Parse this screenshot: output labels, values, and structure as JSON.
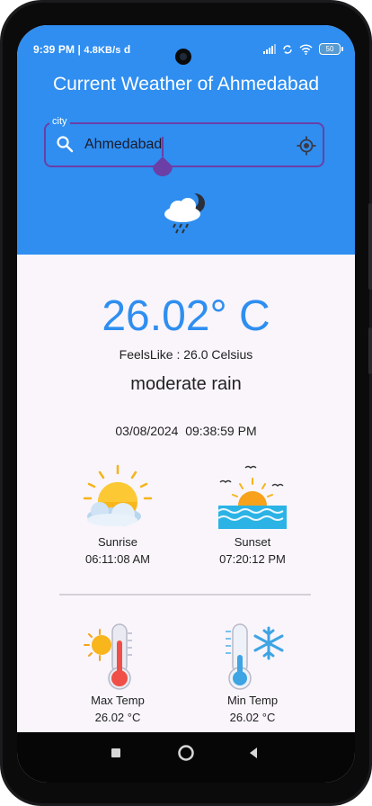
{
  "status_bar": {
    "time": "9:39 PM",
    "speed": "4.8KB/s",
    "carrier_glyph": "d",
    "battery": "50"
  },
  "header": {
    "title": "Current Weather of Ahmedabad"
  },
  "city_field": {
    "label": "city",
    "value": "Ahmedabad"
  },
  "weather": {
    "temperature": "26.02° C",
    "feels_like": "FeelsLike : 26.0 Celsius",
    "description": "moderate rain",
    "datetime": "03/08/2024  09:38:59 PM"
  },
  "tiles": {
    "sunrise": {
      "label": "Sunrise",
      "value": "06:11:08 AM"
    },
    "sunset": {
      "label": "Sunset",
      "value": "07:20:12 PM"
    },
    "max_temp": {
      "label": "Max Temp",
      "value": "26.02 °C"
    },
    "min_temp": {
      "label": "Min Temp",
      "value": "26.02 °C"
    }
  },
  "colors": {
    "header": "#2f8ef0",
    "accent": "#6b3fa6",
    "background": "#f9f5fb"
  }
}
